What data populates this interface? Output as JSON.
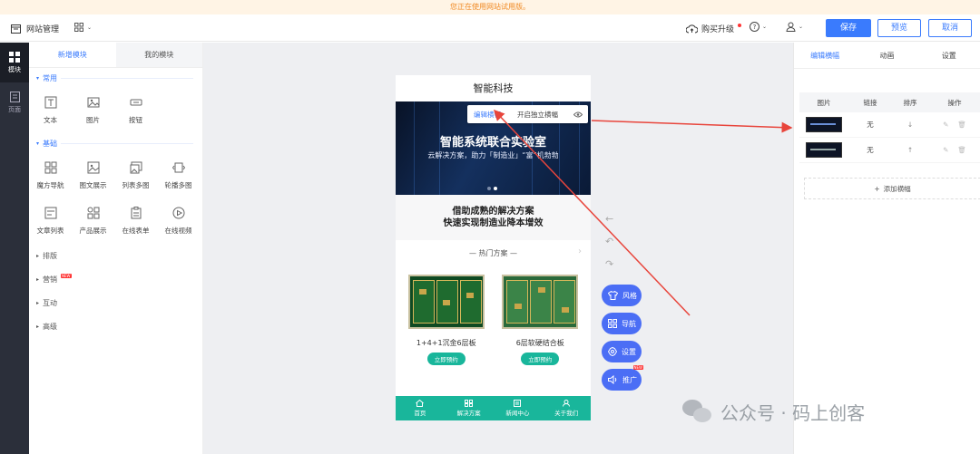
{
  "notice": "您正在使用网站试用版。",
  "topbar": {
    "site_label": "网站管理",
    "buy_label": "购买升级",
    "save": "保存",
    "preview": "预览",
    "cancel": "取消"
  },
  "leftnav": [
    {
      "label": "模块"
    },
    {
      "label": "页面"
    }
  ],
  "panel": {
    "tabs": [
      "新增模块",
      "我的模块"
    ],
    "common_title": "常用",
    "common": [
      "文本",
      "图片",
      "按钮"
    ],
    "basic_title": "基础",
    "basic": [
      "魔方导航",
      "图文展示",
      "列表多图",
      "轮播多图",
      "文章列表",
      "产品展示",
      "在线表单",
      "在线视频"
    ],
    "groups": [
      "排版",
      "营销",
      "互动",
      "高级"
    ],
    "new_badge": "NEW"
  },
  "phone": {
    "title": "智能科技",
    "banner_title": "智能系统联合实验室",
    "banner_sub": "云解决方案，助力「制造业」“富”机勃勃",
    "popup_edit": "编辑横幅",
    "popup_toggle": "开启独立横幅",
    "slogan_1": "借助成熟的解决方案",
    "slogan_2": "快速实现制造业降本增效",
    "hot_title": "— 热门方案 —",
    "products": [
      {
        "name": "1+4+1沉金6层板",
        "button": "立即预约"
      },
      {
        "name": "6层软硬结合板",
        "button": "立即预约"
      }
    ],
    "tabbar": [
      "首页",
      "解决方案",
      "新闻中心",
      "关于我们"
    ]
  },
  "float_buttons": [
    "风格",
    "导航",
    "设置",
    "推广"
  ],
  "right_panel": {
    "tabs": [
      "编辑横幅",
      "动画",
      "设置"
    ],
    "headers": [
      "图片",
      "链接",
      "排序",
      "操作"
    ],
    "rows": [
      {
        "link": "无",
        "sort": "↓"
      },
      {
        "link": "无",
        "sort": "↑"
      }
    ],
    "add_label": "添加横幅"
  },
  "watermark": "公众号 · 码上创客",
  "colors": {
    "primary": "#3a7bfd",
    "teal": "#19b69b",
    "float": "#4b6ef5",
    "arrow": "#e8453c"
  }
}
